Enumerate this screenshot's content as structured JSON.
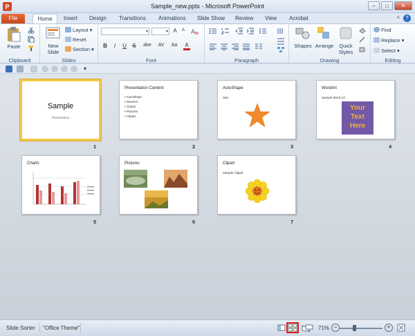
{
  "window": {
    "title": "Sample_new.pptx - Microsoft PowerPoint"
  },
  "tabs": [
    "File",
    "Home",
    "Insert",
    "Design",
    "Transitions",
    "Animations",
    "Slide Show",
    "Review",
    "View",
    "Acrobat"
  ],
  "ribbon": {
    "clipboard": {
      "paste": "Paste",
      "label": "Clipboard"
    },
    "slides": {
      "new_slide": "New",
      "new_slide2": "Slide",
      "layout": "Layout",
      "reset": "Reset",
      "section": "Section",
      "label": "Slides"
    },
    "font": {
      "label": "Font",
      "bold": "B",
      "italic": "I",
      "underline": "U",
      "strike": "S",
      "shadow": "abe",
      "spacing": "AV",
      "case": "Aa",
      "color": "A",
      "grow": "A",
      "shrink": "A"
    },
    "paragraph": {
      "label": "Paragraph"
    },
    "drawing": {
      "shapes": "Shapes",
      "arrange": "Arrange",
      "quick_styles": "Quick",
      "quick_styles2": "Styles",
      "label": "Drawing"
    },
    "editing": {
      "find": "Find",
      "replace": "Replace",
      "select": "Select",
      "label": "Editing"
    }
  },
  "slides": [
    {
      "num": "1",
      "title": "Sample",
      "subtitle": "Presentation",
      "selected": true
    },
    {
      "num": "2",
      "title": "Presentation  Content",
      "bullets": [
        "AutoShape",
        "WordArt",
        "Charts",
        "Pictures",
        "Clipart"
      ]
    },
    {
      "num": "3",
      "title": "AutoShape",
      "subtitle": "Star"
    },
    {
      "num": "4",
      "title": "WordArt",
      "subtitle": "Sample Word Art",
      "wordart": [
        "Your",
        "Text",
        "Here"
      ]
    },
    {
      "num": "5",
      "title": "Charts"
    },
    {
      "num": "6",
      "title": "Pictures"
    },
    {
      "num": "7",
      "title": "Clipart",
      "subtitle": "Sample Clipart"
    }
  ],
  "colors": {
    "accent": "#f3c94a",
    "file_tab": "#d4571f",
    "star": "#f08a2a",
    "wordart_bg": "#7358a8",
    "wordart_text": "#f1b13a",
    "chart_bar": "#b5312f"
  },
  "status": {
    "view": "Slide Sorter",
    "theme": "\"Office Theme\"",
    "zoom": "71%"
  }
}
